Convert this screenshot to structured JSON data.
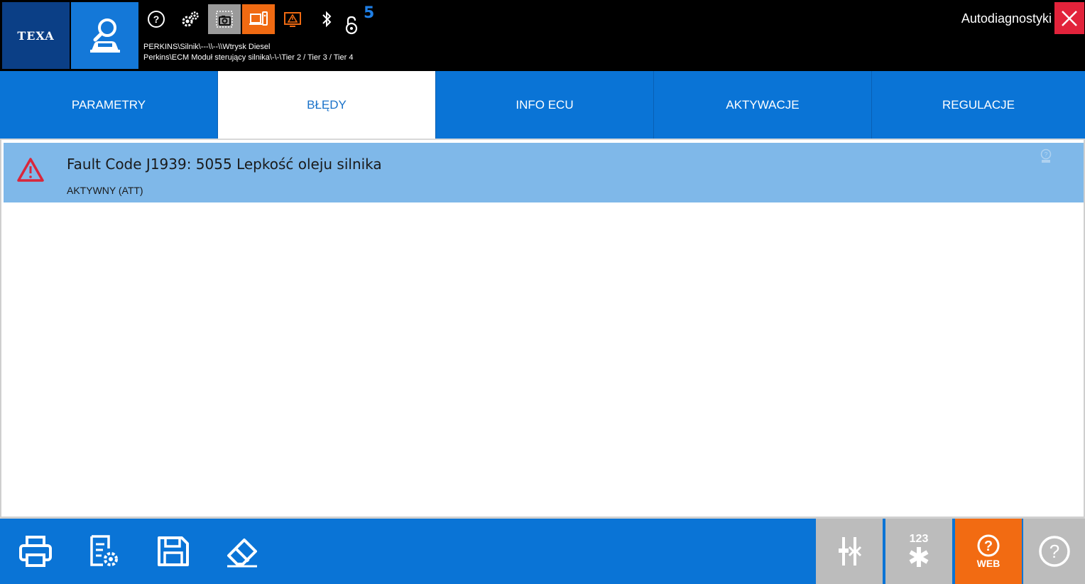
{
  "header": {
    "logo": "TEXA",
    "app_title": "Autodiagnostyki",
    "badge": "5",
    "path_line1": "PERKINS\\Silnik\\---\\\\--\\\\Wtrysk Diesel",
    "path_line2": "Perkins\\ECM Moduł sterujący silnika\\-\\-\\Tier 2 / Tier 3 / Tier 4",
    "icons": [
      "help-icon",
      "settings-icon",
      "screenshot-icon",
      "device-icon",
      "warning-icon",
      "bluetooth-icon",
      "lock-icon"
    ]
  },
  "tabs": [
    {
      "label": "PARAMETRY"
    },
    {
      "label": "BŁĘDY"
    },
    {
      "label": "INFO ECU"
    },
    {
      "label": "AKTYWACJE"
    },
    {
      "label": "REGULACJE"
    }
  ],
  "active_tab": "BŁĘDY",
  "faults": [
    {
      "title": "Fault Code J1939: 5055 Lepkość oleju silnika",
      "status": "AKTYWNY (ATT)"
    }
  ],
  "bottom_toolbar": {
    "left_buttons": [
      "print-icon",
      "settings-doc-icon",
      "save-icon",
      "erase-icon"
    ],
    "counter_label": "123",
    "web_label": "WEB"
  },
  "colors": {
    "accent_blue": "#0a74d6",
    "selected_row": "#7fb8e9",
    "web_orange": "#f26b12",
    "close_red": "#e2233b",
    "warning_red": "#d9263b"
  }
}
